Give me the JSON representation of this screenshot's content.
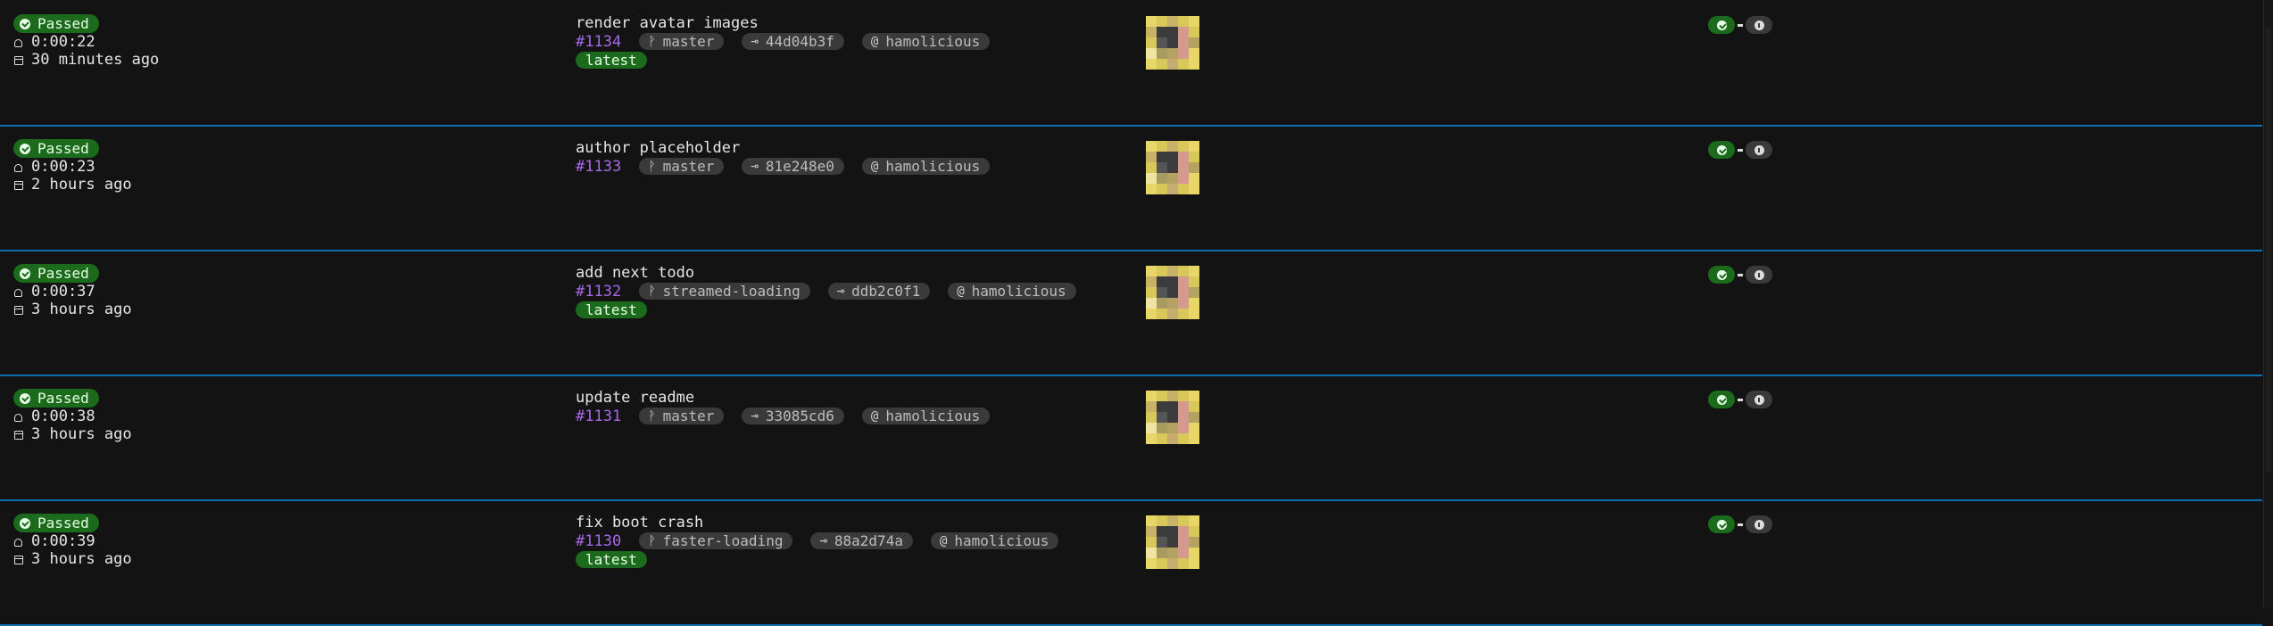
{
  "builds": [
    {
      "status": "Passed",
      "duration": "0:00:22",
      "time_ago": "30 minutes ago",
      "message": "render avatar images",
      "number": "#1134",
      "branch": "master",
      "commit": "44d04b3f",
      "author": "hamolicious",
      "latest": "latest"
    },
    {
      "status": "Passed",
      "duration": "0:00:23",
      "time_ago": "2 hours ago",
      "message": "author placeholder",
      "number": "#1133",
      "branch": "master",
      "commit": "81e248e0",
      "author": "hamolicious",
      "latest": ""
    },
    {
      "status": "Passed",
      "duration": "0:00:37",
      "time_ago": "3 hours ago",
      "message": "add next todo",
      "number": "#1132",
      "branch": "streamed-loading",
      "commit": "ddb2c0f1",
      "author": "hamolicious",
      "latest": "latest"
    },
    {
      "status": "Passed",
      "duration": "0:00:38",
      "time_ago": "3 hours ago",
      "message": "update readme",
      "number": "#1131",
      "branch": "master",
      "commit": "33085cd6",
      "author": "hamolicious",
      "latest": ""
    },
    {
      "status": "Passed",
      "duration": "0:00:39",
      "time_ago": "3 hours ago",
      "message": "fix boot crash",
      "number": "#1130",
      "branch": "faster-loading",
      "commit": "88a2d74a",
      "author": "hamolicious",
      "latest": "latest"
    }
  ],
  "icons": {
    "status": "check-circle-icon",
    "duration": "timer-icon",
    "time": "calendar-icon",
    "branch": "branch-icon",
    "commit": "commit-icon",
    "author": "at-icon",
    "info": "info-icon"
  },
  "colors": {
    "passed": "#1c6b1c",
    "build_number": "#a569e8",
    "divider": "#0d6fae",
    "pill": "#3a3a3a"
  },
  "avatar_palette": [
    "#e8d668",
    "#d8c85a",
    "#c9b268",
    "#b4a262",
    "#3c3c3c",
    "#555555",
    "#d49a8e",
    "#c6ad6f",
    "#a99b60",
    "#efe4a0"
  ]
}
